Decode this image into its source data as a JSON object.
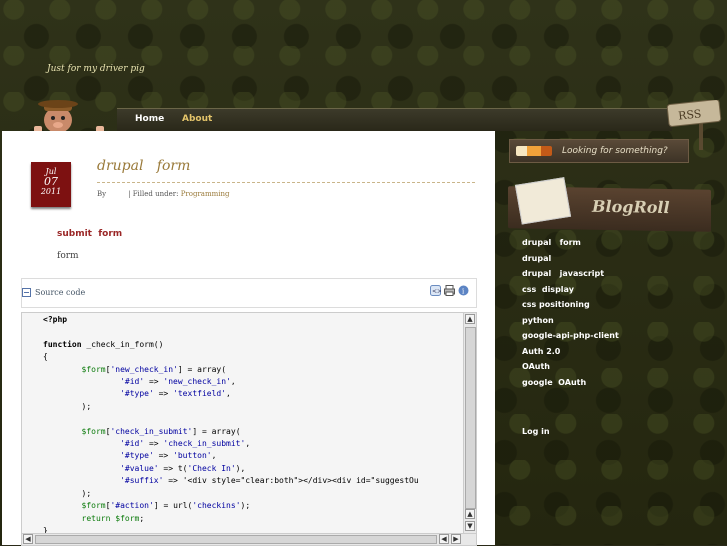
{
  "site": {
    "tagline": "Just for my driver pig"
  },
  "nav": {
    "items": [
      "Home",
      "About"
    ]
  },
  "rss": {
    "label": "RSS"
  },
  "post": {
    "date": {
      "month": "Jul",
      "day": "07",
      "year": "2011"
    },
    "title": "drupal   form",
    "by_label": "By",
    "filed_label": "| Filled under:",
    "category": "Programming",
    "link_text": "submit  form",
    "text": "form"
  },
  "code_block": {
    "label": "Source code",
    "lines": [
      "<?php",
      "",
      "function _check_in_form()",
      "{",
      "        $form['new_check_in'] = array(",
      "                '#id' => 'new_check_in',",
      "                '#type' => 'textfield',",
      "        );",
      "",
      "        $form['check_in_submit'] = array(",
      "                '#id' => 'check_in_submit',",
      "                '#type' => 'button',",
      "                '#value' => t('Check In'),",
      "                '#suffix' => '<div style=\"clear:both\"></div><div id=\"suggestOu",
      "        );",
      "        $form['#action'] = url('checkins');",
      "        return $form;",
      "}"
    ]
  },
  "sidebar": {
    "search_placeholder": "Looking for something?",
    "blogroll_title": "BlogRoll",
    "links": [
      "drupal   form",
      "drupal",
      "drupal   javascript",
      "css  display",
      "css positioning",
      "python",
      "google-api-php-client",
      "Auth 2.0",
      "OAuth",
      "google  OAuth"
    ],
    "login": "Log in"
  },
  "colors": {
    "accent": "#9a7a3a",
    "date_badge": "#7d1111",
    "nav_active": "#e3c46a"
  }
}
